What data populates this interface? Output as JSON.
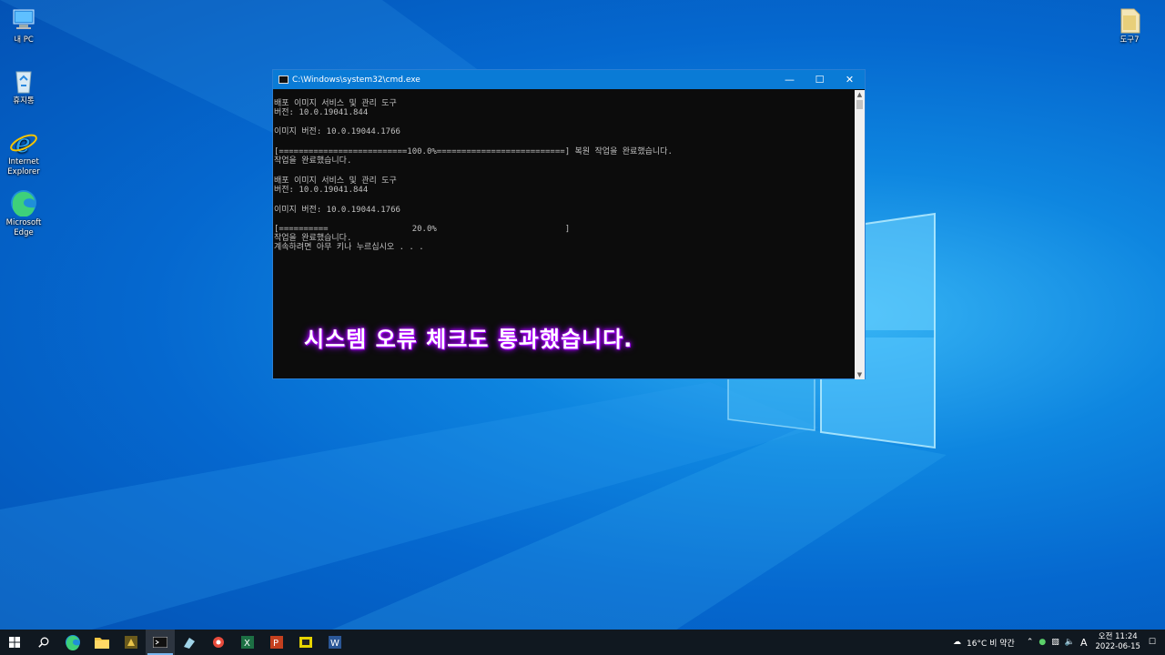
{
  "desktop": {
    "icons": [
      {
        "label": "내 PC",
        "icon": "this-pc-icon"
      },
      {
        "label": "휴지통",
        "icon": "recycle-bin-icon"
      },
      {
        "label": "Internet Explorer",
        "icon": "internet-explorer-icon"
      },
      {
        "label": "Microsoft Edge",
        "icon": "edge-icon"
      },
      {
        "label": "도구7",
        "icon": "folder-icon"
      }
    ]
  },
  "cmd": {
    "title": "C:\\Windows\\system32\\cmd.exe",
    "lines": [
      "배포 이미지 서비스 및 관리 도구",
      "버전: 10.0.19041.844",
      "",
      "이미지 버전: 10.0.19044.1766",
      "",
      "[==========================100.0%==========================] 복원 작업을 완료했습니다.",
      "작업을 완료했습니다.",
      "",
      "배포 이미지 서비스 및 관리 도구",
      "버전: 10.0.19041.844",
      "",
      "이미지 버전: 10.0.19044.1766",
      "",
      "[==========                 20.0%                          ]",
      "작업을 완료했습니다.",
      "계속하려면 아무 키나 누르십시오 . . ."
    ],
    "caption": "시스템 오류 체크도 통과했습니다."
  },
  "taskbar": {
    "apps": [
      "start-icon",
      "search-icon",
      "edge-icon",
      "file-explorer-icon",
      "app-icon",
      "cmd-icon",
      "app-icon",
      "app-icon",
      "excel-icon",
      "powerpoint-icon",
      "app-icon",
      "word-icon"
    ],
    "weather": "16°C 비 약간",
    "ime": "A",
    "time": "오전 11:24",
    "date": "2022-06-15"
  },
  "colors": {
    "accent": "#0a7bd6",
    "console_bg": "#0c0c0c",
    "console_text": "#c0c0c0",
    "caption_glow": "#b400ff"
  }
}
